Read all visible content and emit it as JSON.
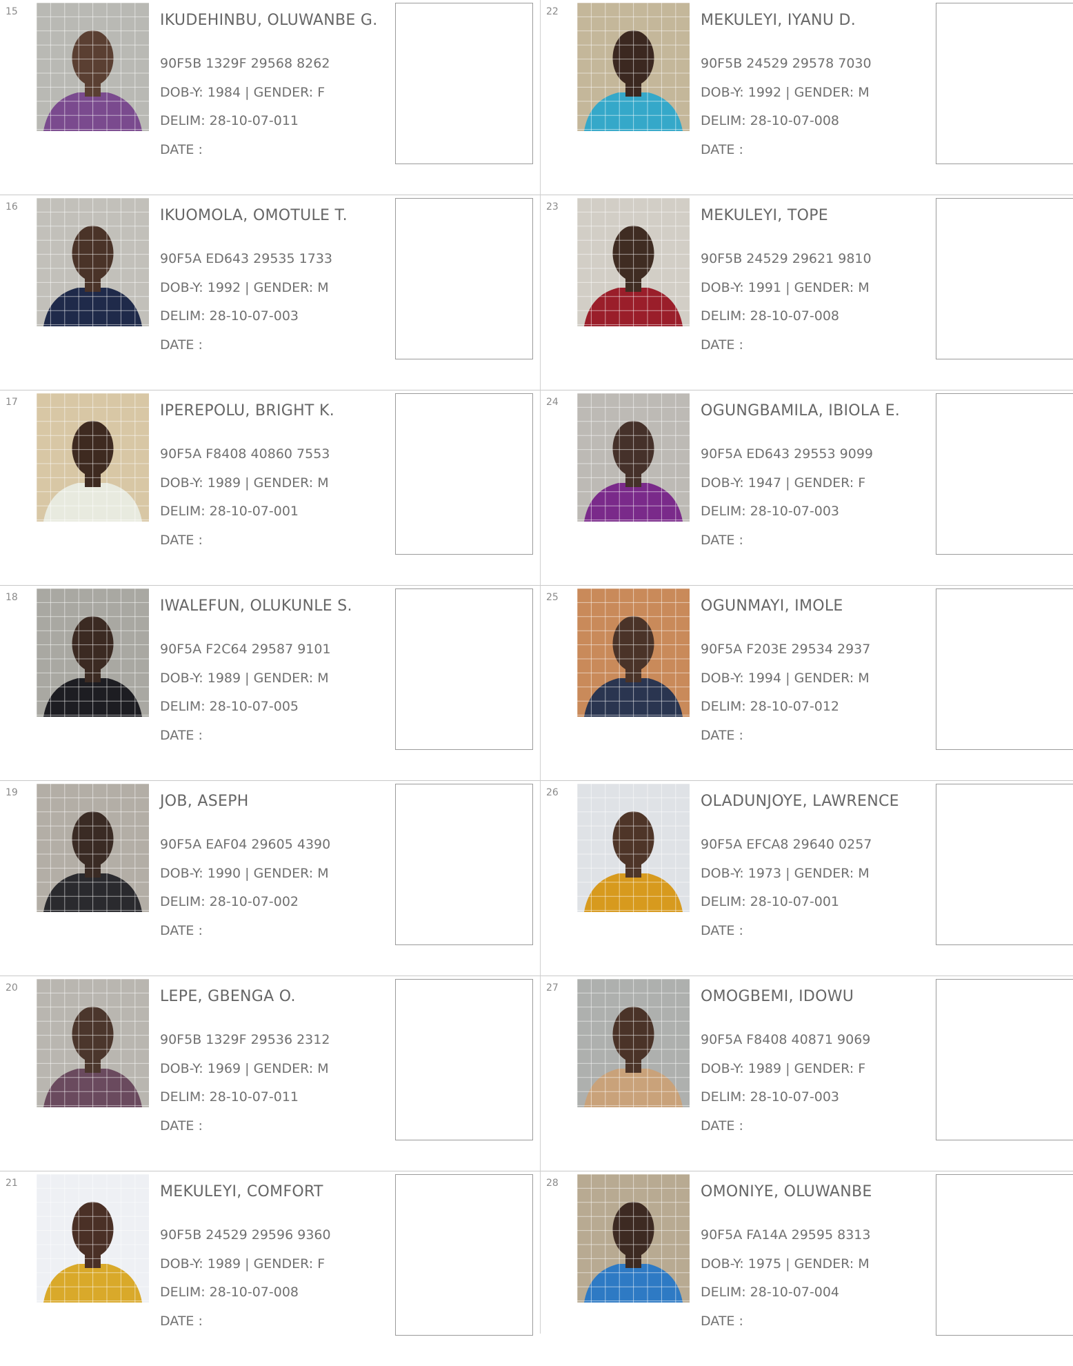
{
  "columns": [
    {
      "entries": [
        {
          "num": "15",
          "name": "IKUDEHINBU, OLUWANBE G.",
          "code": "90F5B 1329F 29568 8262",
          "dob": "DOB-Y: 1984  | GENDER: F",
          "delim": "DELIM: 28-10-07-011",
          "date": "DATE  :",
          "photo": {
            "bg": "#b9b9b4",
            "skin": "#5a3f32",
            "shirt": "#7a4a8e"
          }
        },
        {
          "num": "16",
          "name": "IKUOMOLA, OMOTULE T.",
          "code": "90F5A ED643 29535 1733",
          "dob": "DOB-Y: 1992  | GENDER: M",
          "delim": "DELIM: 28-10-07-003",
          "date": "DATE  :",
          "photo": {
            "bg": "#c2c0ba",
            "skin": "#4a3328",
            "shirt": "#1f2a4a"
          }
        },
        {
          "num": "17",
          "name": "IPEREPOLU, BRIGHT K.",
          "code": "90F5A F8408 40860 7553",
          "dob": "DOB-Y: 1989  | GENDER: M",
          "delim": "DELIM: 28-10-07-001",
          "date": "DATE  :",
          "photo": {
            "bg": "#d8c7a5",
            "skin": "#3e2a20",
            "shirt": "#e8eadf"
          }
        },
        {
          "num": "18",
          "name": "IWALEFUN, OLUKUNLE S.",
          "code": "90F5A F2C64 29587 9101",
          "dob": "DOB-Y: 1989  | GENDER: M",
          "delim": "DELIM: 28-10-07-005",
          "date": "DATE  :",
          "photo": {
            "bg": "#a9a8a2",
            "skin": "#3b2a22",
            "shirt": "#1d1d22"
          }
        },
        {
          "num": "19",
          "name": "JOB, ASEPH",
          "code": "90F5A EAF04 29605 4390",
          "dob": "DOB-Y: 1990  | GENDER: M",
          "delim": "DELIM: 28-10-07-002",
          "date": "DATE  :",
          "photo": {
            "bg": "#b3aea6",
            "skin": "#3a2b24",
            "shirt": "#2a2a2e"
          }
        },
        {
          "num": "20",
          "name": "LEPE, GBENGA O.",
          "code": "90F5B 1329F 29536 2312",
          "dob": "DOB-Y: 1969  | GENDER: M",
          "delim": "DELIM: 28-10-07-011",
          "date": "DATE  :",
          "photo": {
            "bg": "#b9b6b0",
            "skin": "#4b362c",
            "shirt": "#6a4a5e"
          }
        },
        {
          "num": "21",
          "name": "MEKULEYI, COMFORT",
          "code": "90F5B 24529 29596 9360",
          "dob": "DOB-Y: 1989  | GENDER: F",
          "delim": "DELIM: 28-10-07-008",
          "date": "DATE  :",
          "photo": {
            "bg": "#eef0f4",
            "skin": "#4a3026",
            "shirt": "#d9a92a"
          }
        }
      ]
    },
    {
      "entries": [
        {
          "num": "22",
          "name": "MEKULEYI, IYANU D.",
          "code": "90F5B 24529 29578 7030",
          "dob": "DOB-Y: 1992  | GENDER: M",
          "delim": "DELIM: 28-10-07-008",
          "date": "DATE  :",
          "photo": {
            "bg": "#c4b79a",
            "skin": "#3b2820",
            "shirt": "#35a8c9"
          }
        },
        {
          "num": "23",
          "name": "MEKULEYI, TOPE",
          "code": "90F5B 24529 29621 9810",
          "dob": "DOB-Y: 1991  | GENDER: M",
          "delim": "DELIM: 28-10-07-008",
          "date": "DATE  :",
          "photo": {
            "bg": "#d2cec6",
            "skin": "#3f2c22",
            "shirt": "#9a1e2a"
          }
        },
        {
          "num": "24",
          "name": "OGUNGBAMILA, IBIOLA E.",
          "code": "90F5A ED643 29553 9099",
          "dob": "DOB-Y: 1947  | GENDER: F",
          "delim": "DELIM: 28-10-07-003",
          "date": "DATE  :",
          "photo": {
            "bg": "#bdbab5",
            "skin": "#45312a",
            "shirt": "#7a2a8a"
          }
        },
        {
          "num": "25",
          "name": "OGUNMAYI, IMOLE",
          "code": "90F5A F203E 29534 2937",
          "dob": "DOB-Y: 1994  | GENDER: M",
          "delim": "DELIM: 28-10-07-012",
          "date": "DATE  :",
          "photo": {
            "bg": "#c98a5a",
            "skin": "#4a3328",
            "shirt": "#2a3550"
          }
        },
        {
          "num": "26",
          "name": "OLADUNJOYE, LAWRENCE",
          "code": "90F5A EFCA8 29640 0257",
          "dob": "DOB-Y: 1973  | GENDER: M",
          "delim": "DELIM: 28-10-07-001",
          "date": "DATE  :",
          "photo": {
            "bg": "#dfe2e6",
            "skin": "#4e3528",
            "shirt": "#d79a1e"
          }
        },
        {
          "num": "27",
          "name": "OMOGBEMI, IDOWU",
          "code": "90F5A F8408 40871 9069",
          "dob": "DOB-Y: 1989  | GENDER: F",
          "delim": "DELIM: 28-10-07-003",
          "date": "DATE  :",
          "photo": {
            "bg": "#aeb0ae",
            "skin": "#4a3328",
            "shirt": "#c9a27a"
          }
        },
        {
          "num": "28",
          "name": "OMONIYE, OLUWANBE",
          "code": "90F5A FA14A 29595 8313",
          "dob": "DOB-Y: 1975  | GENDER: M",
          "delim": "DELIM: 28-10-07-004",
          "date": "DATE  :",
          "photo": {
            "bg": "#b8aa92",
            "skin": "#3d2a22",
            "shirt": "#2e7ac4"
          }
        }
      ]
    }
  ]
}
